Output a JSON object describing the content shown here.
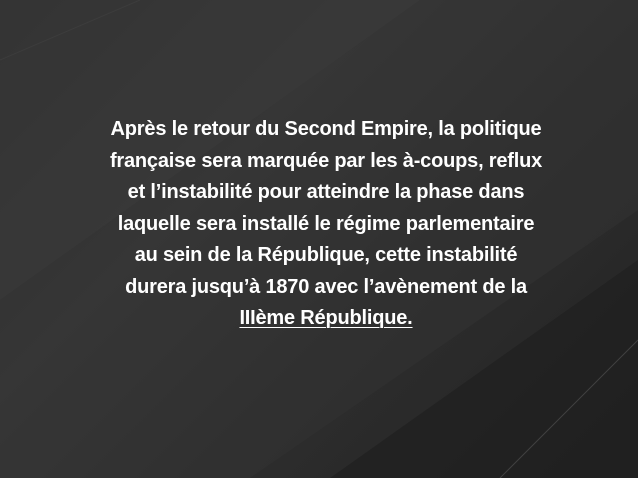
{
  "slide": {
    "lines": [
      "Après le retour du Second Empire, la politique",
      "française sera marquée par les à-coups, reflux",
      "et l’instabilité pour atteindre la phase dans",
      "laquelle sera installé le régime parlementaire",
      "au sein de la République, cette instabilité",
      "durera jusqu’à 1870 avec l’avènement de la",
      "IIIème République."
    ]
  },
  "theme": {
    "text_color": "#ffffff",
    "background_color": "#2b2b2b"
  }
}
